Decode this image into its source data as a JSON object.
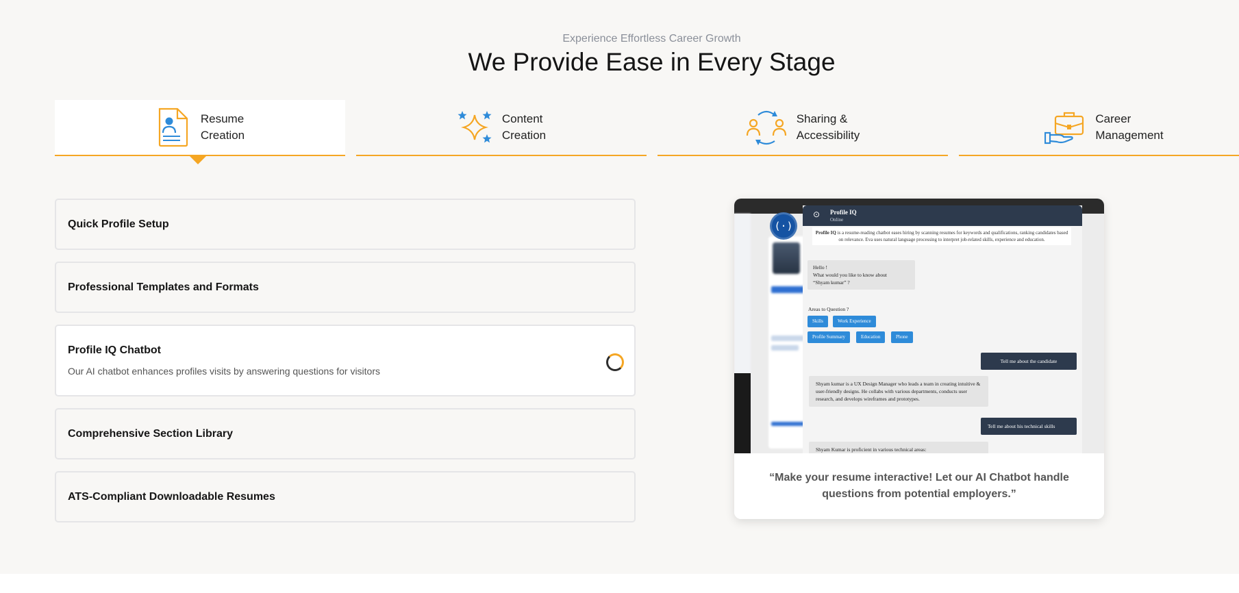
{
  "header": {
    "eyebrow": "Experience Effortless Career Growth",
    "title": "We Provide Ease in Every Stage"
  },
  "tabs": [
    {
      "line1": "Resume",
      "line2": "Creation",
      "icon": "resume-document-icon",
      "active": true
    },
    {
      "line1": "Content",
      "line2": "Creation",
      "icon": "sparkle-stars-icon",
      "active": false
    },
    {
      "line1": "Sharing &",
      "line2": "Accessibility",
      "icon": "people-sharing-icon",
      "active": false
    },
    {
      "line1": "Career",
      "line2": "Management",
      "icon": "briefcase-hand-icon",
      "active": false
    }
  ],
  "accordion": [
    {
      "title": "Quick Profile Setup",
      "open": false
    },
    {
      "title": "Professional Templates and Formats",
      "open": false
    },
    {
      "title": "Profile IQ Chatbot",
      "open": true,
      "description": "Our AI chatbot enhances profiles visits by answering questions for visitors"
    },
    {
      "title": "Comprehensive Section Library",
      "open": false
    },
    {
      "title": "ATS-Compliant Downloadable Resumes",
      "open": false
    }
  ],
  "preview": {
    "chat": {
      "name": "Profile IQ",
      "status": "Online",
      "intro_bold": "Profile IQ",
      "intro_rest": " is a resume-reading chatbot eases hiring by scanning resumes for keywords and qualifications, ranking candidates based on relevance. Eva uses natural language processing to interpret job-related skills, experience and education.",
      "greeting_line1": "Hello !",
      "greeting_line2": "What would you like to know about",
      "greeting_line3": "“Shyam kumar” ?",
      "areas_label": "Areas to Question ?",
      "chips": [
        "Skills",
        "Work Experience",
        "Profile Summary",
        "Education",
        "Phone"
      ],
      "user_msg_1": "Tell me about the candidate",
      "bot_reply_1": "Shyam kumar is a UX Design Manager who leads a team in creating intuitive & user-friendly designs. He collabs with various departments, conducts user research, and develops wireframes and prototypes.",
      "user_msg_2": "Tell me about his technical skills",
      "bot_reply_2": "Shyam Kumar is proficient in various technical areas:"
    },
    "quote": "“Make your resume interactive! Let our AI Chatbot handle questions from potential employers.”"
  },
  "colors": {
    "accent": "#f5a623",
    "blue": "#2e8bd9",
    "chat_header": "#2d3a4d",
    "background": "#f8f7f5"
  }
}
